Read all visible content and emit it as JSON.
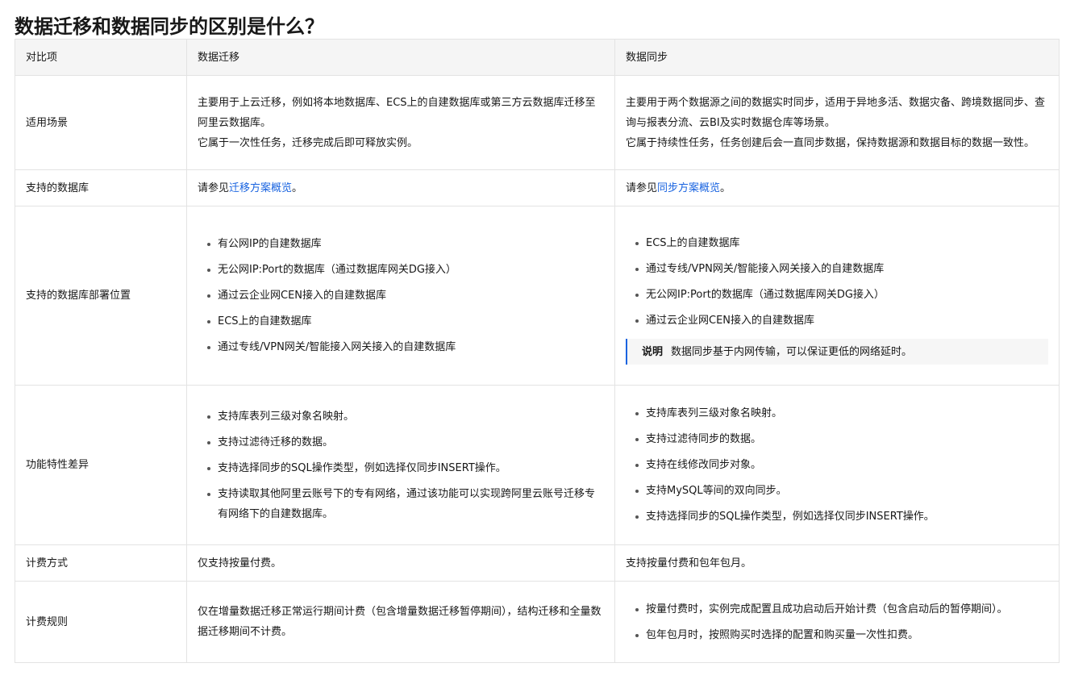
{
  "title": "数据迁移和数据同步的区别是什么？",
  "headers": [
    "对比项",
    "数据迁移",
    "数据同步"
  ],
  "rows": {
    "scene": {
      "label": "适用场景",
      "migration": [
        "主要用于上云迁移，例如将本地数据库、ECS上的自建数据库或第三方云数据库迁移至阿里云数据库。",
        "它属于一次性任务，迁移完成后即可释放实例。"
      ],
      "sync": [
        "主要用于两个数据源之间的数据实时同步，适用于异地多活、数据灾备、跨境数据同步、查询与报表分流、云BI及实时数据仓库等场景。",
        "它属于持续性任务，任务创建后会一直同步数据，保持数据源和数据目标的数据一致性。"
      ]
    },
    "db": {
      "label": "支持的数据库",
      "migration_prefix": "请参见",
      "migration_link": "迁移方案概览",
      "migration_suffix": "。",
      "sync_prefix": "请参见",
      "sync_link": "同步方案概览",
      "sync_suffix": "。"
    },
    "deploy": {
      "label": "支持的数据库部署位置",
      "migration": [
        "有公网IP的自建数据库",
        "无公网IP:Port的数据库（通过数据库网关DG接入）",
        "通过云企业网CEN接入的自建数据库",
        "ECS上的自建数据库",
        "通过专线/VPN网关/智能接入网关接入的自建数据库"
      ],
      "sync": [
        "ECS上的自建数据库",
        "通过专线/VPN网关/智能接入网关接入的自建数据库",
        "无公网IP:Port的数据库（通过数据库网关DG接入）",
        "通过云企业网CEN接入的自建数据库"
      ],
      "note_title": "说明",
      "note_text": "数据同步基于内网传输，可以保证更低的网络延时。"
    },
    "feature": {
      "label": "功能特性差异",
      "migration": [
        "支持库表列三级对象名映射。",
        "支持过滤待迁移的数据。",
        "支持选择同步的SQL操作类型，例如选择仅同步INSERT操作。",
        "支持读取其他阿里云账号下的专有网络，通过该功能可以实现跨阿里云账号迁移专有网络下的自建数据库。"
      ],
      "sync": [
        "支持库表列三级对象名映射。",
        "支持过滤待同步的数据。",
        "支持在线修改同步对象。",
        "支持MySQL等间的双向同步。",
        "支持选择同步的SQL操作类型，例如选择仅同步INSERT操作。"
      ]
    },
    "pay": {
      "label": "计费方式",
      "migration": "仅支持按量付费。",
      "sync": "支持按量付费和包年包月。"
    },
    "rule": {
      "label": "计费规则",
      "migration": "仅在增量数据迁移正常运行期间计费（包含增量数据迁移暂停期间），结构迁移和全量数据迁移期间不计费。",
      "sync": [
        "按量付费时，实例完成配置且成功启动后开始计费（包含启动后的暂停期间）。",
        "包年包月时，按照购买时选择的配置和购买量一次性扣费。"
      ]
    }
  }
}
